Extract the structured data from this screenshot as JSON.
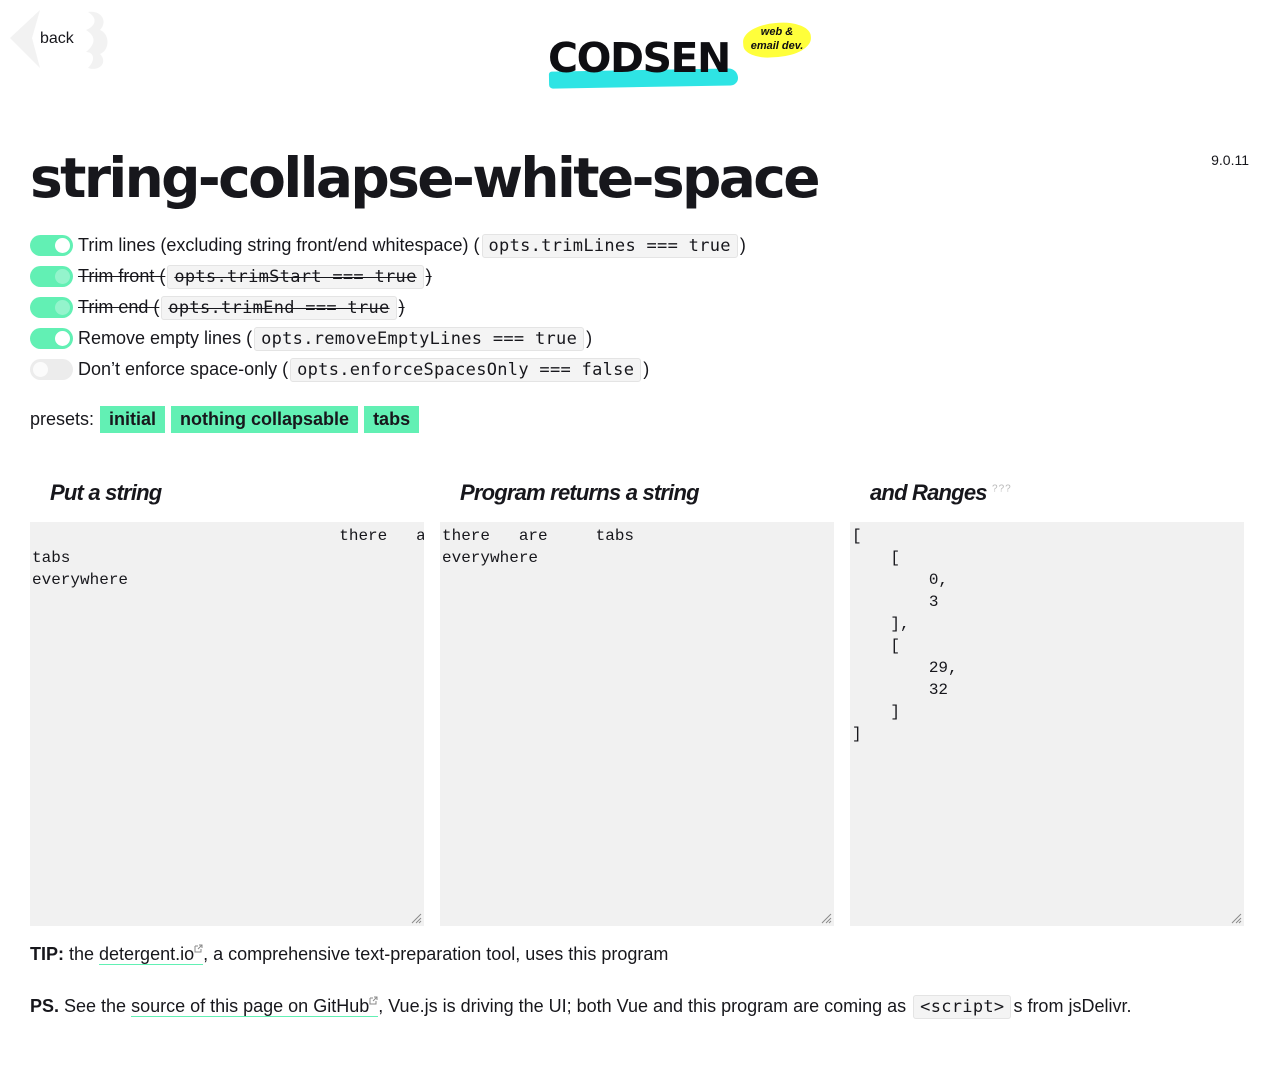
{
  "header": {
    "back_label": "back",
    "logo_text": "CODSEN",
    "logo_badge_line1": "web &",
    "logo_badge_line2": "email dev.",
    "version": "9.0.11"
  },
  "title": "string-collapse-white-space",
  "options": [
    {
      "label": "Trim lines (excluding string front/end whitespace) (",
      "code": "opts.trimLines === true",
      "suffix": ")",
      "enabled": true,
      "struck": false
    },
    {
      "label": "Trim front (",
      "code": "opts.trimStart === true",
      "suffix": ")",
      "enabled": true,
      "struck": true
    },
    {
      "label": "Trim end (",
      "code": "opts.trimEnd === true",
      "suffix": ")",
      "enabled": true,
      "struck": true
    },
    {
      "label": "Remove empty lines (",
      "code": "opts.removeEmptyLines === true",
      "suffix": ")",
      "enabled": true,
      "struck": false
    },
    {
      "label": "Don’t enforce space-only (",
      "code": "opts.enforceSpacesOnly === false",
      "suffix": ")",
      "enabled": false,
      "struck": false
    }
  ],
  "presets": {
    "label": "presets:",
    "items": [
      "initial",
      "nothing collapsable",
      "tabs"
    ]
  },
  "columns": {
    "input_title": "Put a string",
    "output_title": "Program returns a string",
    "ranges_title": "and Ranges",
    "ranges_sup": "???",
    "input_value": "\t\t\t\tthere\tare\t\ntabs\neverywhere",
    "output_value": "there\tare\ttabs\neverywhere",
    "ranges_value": "[\n    [\n        0,\n        3\n    ],\n    [\n        29,\n        32\n    ]\n]"
  },
  "footer": {
    "tip_bold": "TIP:",
    "tip_pre": " the ",
    "tip_link": "detergent.io",
    "tip_post": ", a comprehensive text-preparation tool, uses this program",
    "ps_bold": "PS.",
    "ps_pre": " See the ",
    "ps_link": "source of this page on GitHub",
    "ps_mid": ", Vue.js is driving the UI; both Vue and this program are coming as ",
    "ps_code": "<script>",
    "ps_post": "s from jsDelivr."
  },
  "colors": {
    "accent": "#62f0b4",
    "logo_underline": "#2ee4e4",
    "logo_badge": "#ffff3b",
    "box_bg": "#f1f1f1"
  }
}
